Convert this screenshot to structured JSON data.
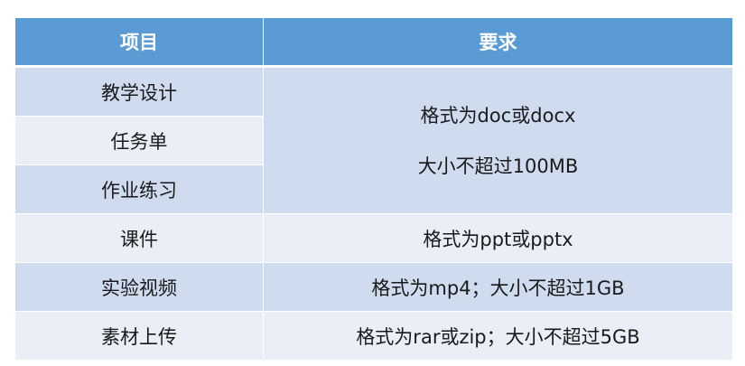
{
  "header": {
    "col1": "项目",
    "col2": "要求"
  },
  "rows": [
    {
      "item": "教学设计"
    },
    {
      "item": "任务单"
    },
    {
      "item": "作业练习"
    },
    {
      "item": "课件",
      "req": "格式为ppt或pptx"
    },
    {
      "item": "实验视频",
      "req": "格式为mp4；大小不超过1GB"
    },
    {
      "item": "素材上传",
      "req": "格式为rar或zip；大小不超过5GB"
    }
  ],
  "merged_req": {
    "line1": "格式为doc或docx",
    "line2": "大小不超过100MB"
  }
}
